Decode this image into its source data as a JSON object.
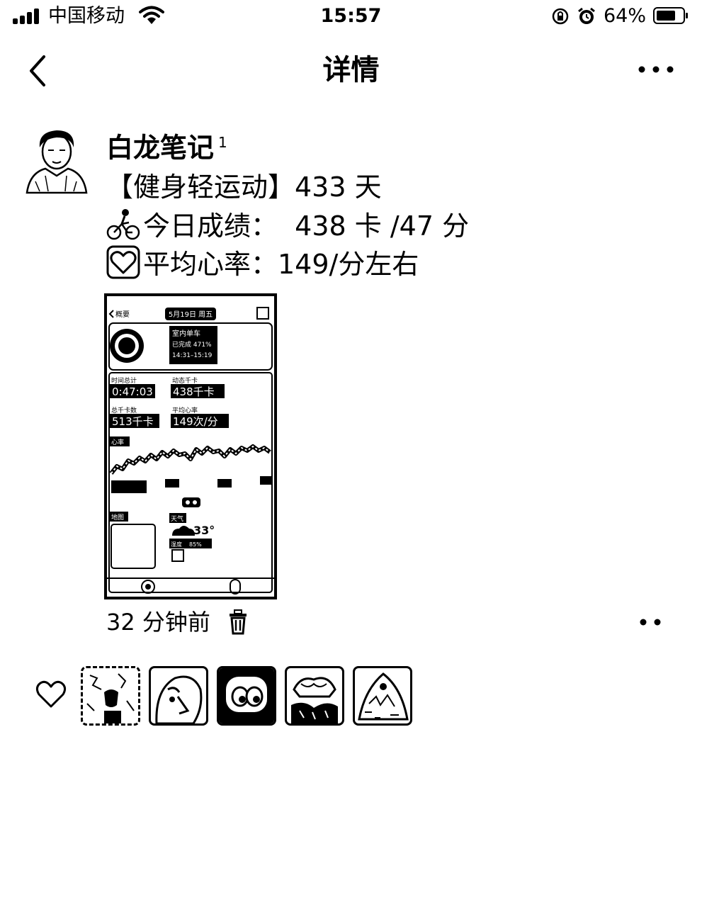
{
  "status_bar": {
    "carrier": "中国移动",
    "time": "15:57",
    "battery_percent": "64%"
  },
  "nav": {
    "title": "详情"
  },
  "post": {
    "username": "白龙笔记",
    "username_badge": "1",
    "line1": "【健身轻运动】433 天",
    "line2": "今日成绩：  438 卡 /47 分",
    "line3": "平均心率：149/分左右",
    "time_ago": "32 分钟前"
  },
  "screenshot": {
    "back_label": "概要",
    "date_label": "5月19日 周五",
    "workout_name": "室内单车",
    "completed": "已完成 471%",
    "time_range": "14:31–15:19",
    "stat1_label": "时间总计",
    "stat1_value": "0:47:03",
    "stat2_label": "动态千卡",
    "stat2_value": "438千卡",
    "stat3_label": "总千卡数",
    "stat3_value": "513千卡",
    "stat4_label": "平均心率",
    "stat4_value": "149次/分",
    "hr_label": "心率",
    "map_label": "地图",
    "weather_label": "天气",
    "temperature": "33°",
    "humidity_label": "湿度",
    "humidity_value": "85%"
  },
  "icons": {
    "back": "chevron-left-icon",
    "more": "ellipsis-icon",
    "bike": "cyclist-emoji-icon",
    "heart": "heart-emoji-icon",
    "delete": "trash-icon",
    "like": "heart-outline-icon"
  }
}
